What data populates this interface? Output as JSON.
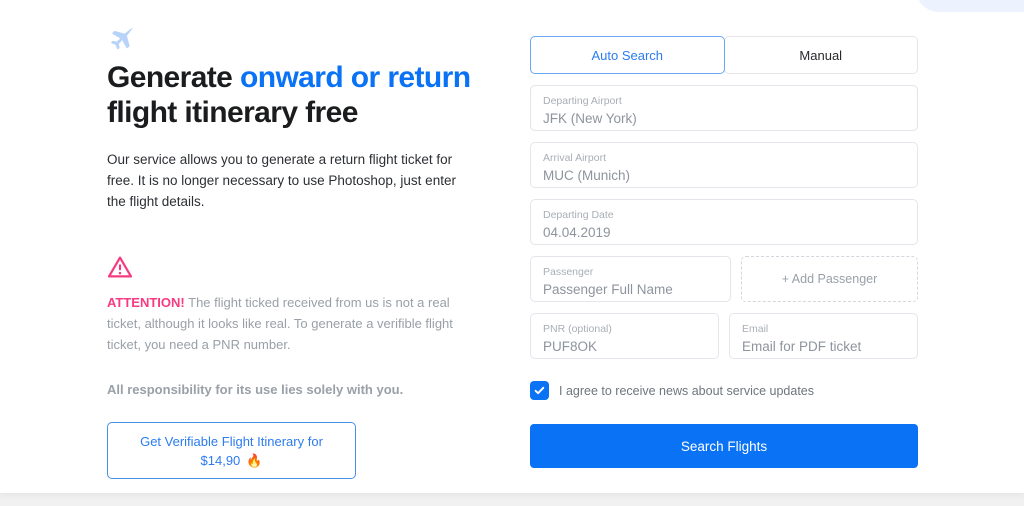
{
  "hero": {
    "plane_icon": "airplane-icon",
    "headline_parts": [
      {
        "text": "Generate ",
        "accent": false
      },
      {
        "text": "onward or",
        "accent": true
      },
      {
        "text": " ",
        "accent": false
      },
      {
        "text": "return",
        "accent": true
      },
      {
        "text": " flight itinerary free",
        "accent": false
      }
    ],
    "headline_plain": "Generate onward or return flight itinerary free",
    "lede": "Our service allows you to generate a return flight ticket for free. It is no longer necessary to use Photoshop, just enter the flight details."
  },
  "warning": {
    "icon": "warning-triangle-icon",
    "label": "ATTENTION!",
    "body": " The flight ticked received from us is not a real ticket, although it looks like real. To generate a verifible flight ticket, you need a PNR number.",
    "responsibility": "All responsibility for its use lies solely with you."
  },
  "cta": {
    "line1": "Get Verifiable Flight Itinerary for",
    "price": "$14,90",
    "fire_icon": "🔥"
  },
  "form": {
    "tabs": [
      {
        "label": "Auto Search",
        "active": true
      },
      {
        "label": "Manual",
        "active": false
      }
    ],
    "fields": {
      "departing_airport": {
        "label": "Departing Airport",
        "value": "JFK (New York)"
      },
      "arrival_airport": {
        "label": "Arrival Airport",
        "value": "MUC (Munich)"
      },
      "departing_date": {
        "label": "Departing Date",
        "value": "04.04.2019"
      },
      "passenger": {
        "label": "Passenger",
        "value": "Passenger Full Name"
      },
      "pnr": {
        "label": "PNR (optional)",
        "value": "PUF8OK"
      },
      "email": {
        "label": "Email",
        "value": "Email for PDF ticket"
      }
    },
    "add_passenger_label": "+ Add Passenger",
    "agree_label": "I agree to receive news about service updates",
    "agree_checked": true,
    "submit_label": "Search Flights"
  },
  "colors": {
    "brand_blue": "#0a72f5",
    "accent_pink": "#f83a81",
    "page_bg": "#f1f1f2",
    "card_bg": "#ffffff",
    "field_border": "#e3e6ea",
    "muted_text": "#9aa0a8"
  }
}
